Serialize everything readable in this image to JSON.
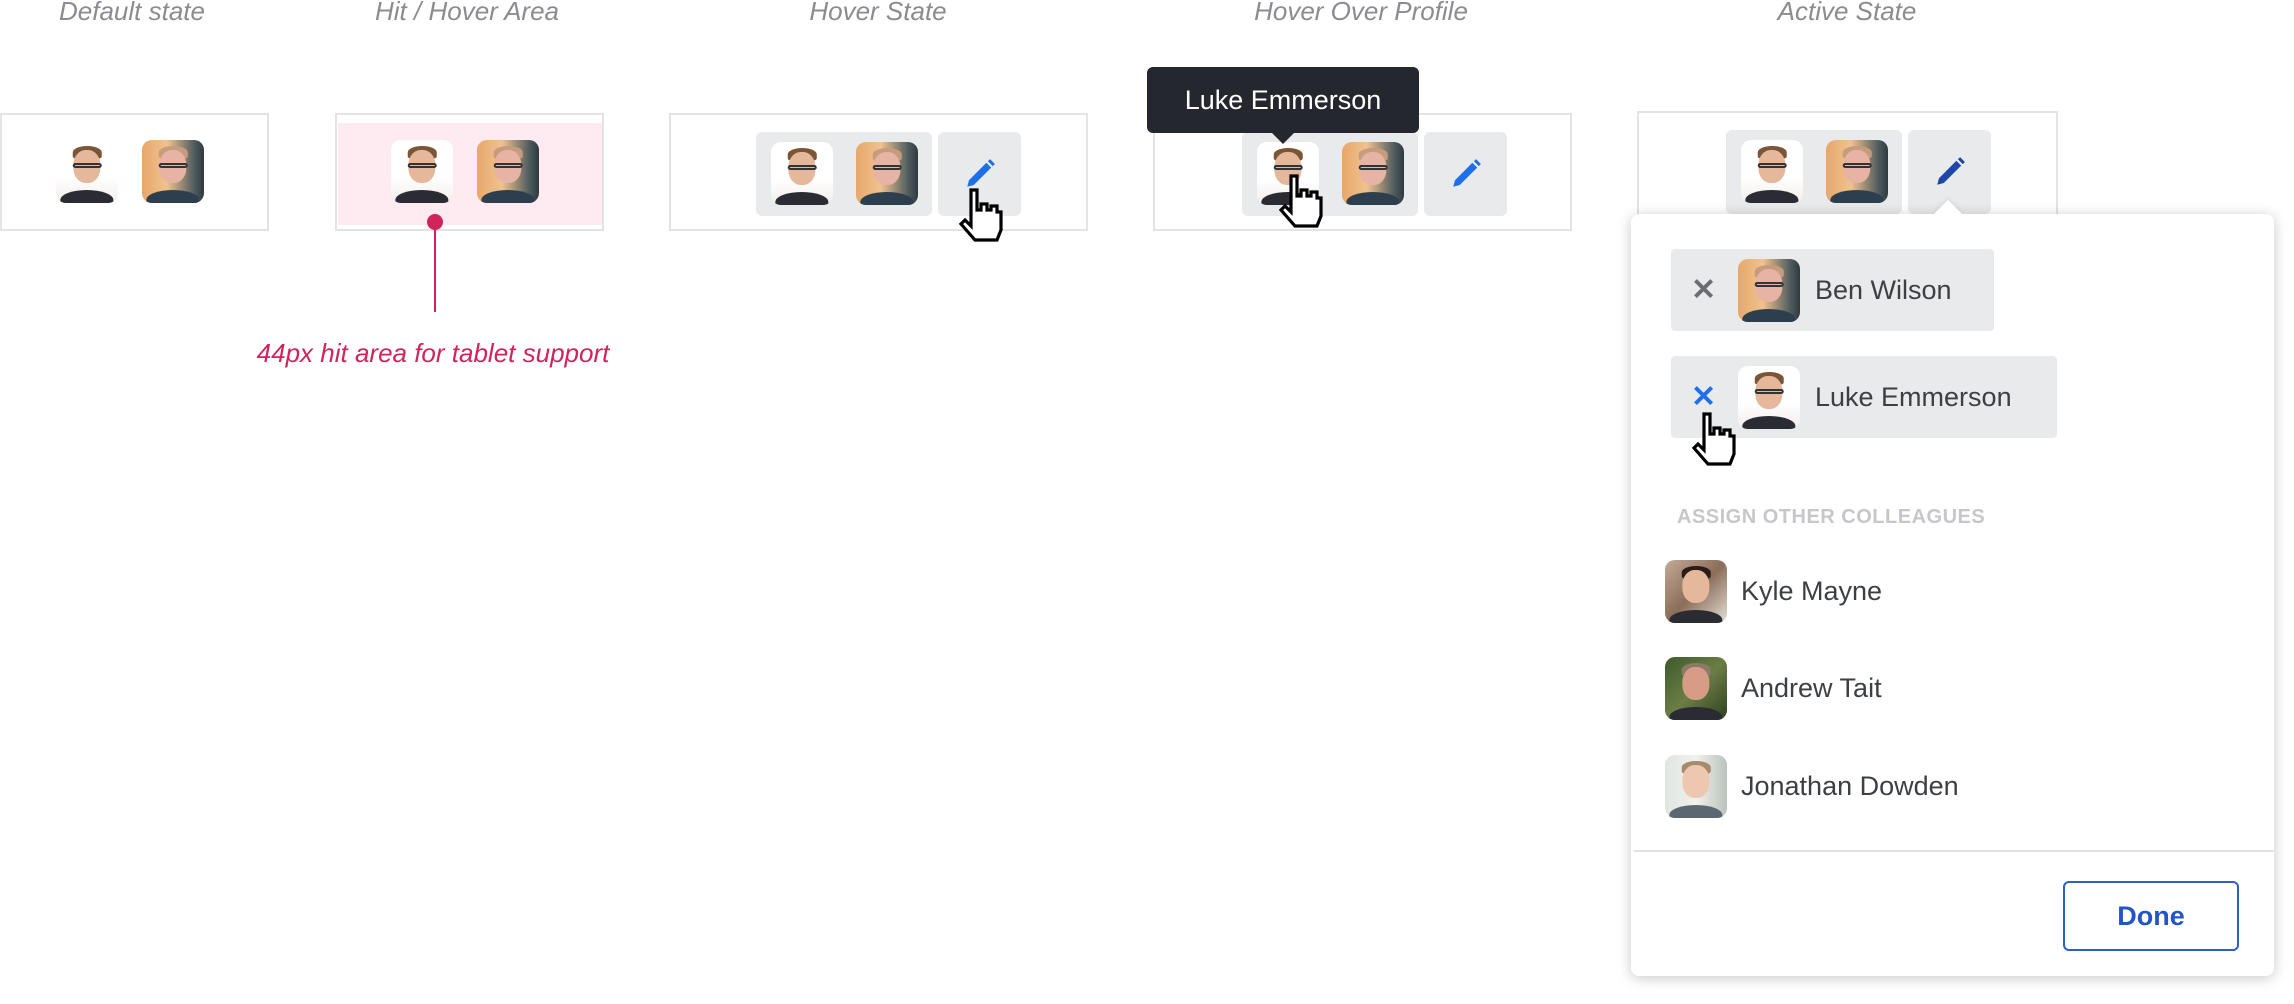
{
  "states": [
    {
      "label": "Default state"
    },
    {
      "label": "Hit / Hover Area"
    },
    {
      "label": "Hover State"
    },
    {
      "label": "Hover Over Profile"
    },
    {
      "label": "Active State"
    }
  ],
  "annotation": {
    "text": "44px hit area for tablet support",
    "color": "#d0245a"
  },
  "tooltip": {
    "text": "Luke Emmerson"
  },
  "assigned": [
    {
      "name": "Ben Wilson",
      "avatar": "ben"
    },
    {
      "name": "Luke Emmerson",
      "avatar": "luke"
    }
  ],
  "section_heading": "ASSIGN OTHER COLLEAGUES",
  "colleagues": [
    {
      "name": "Kyle Mayne",
      "avatar": "kyle"
    },
    {
      "name": "Andrew Tait",
      "avatar": "andrew"
    },
    {
      "name": "Jonathan Dowden",
      "avatar": "jon"
    }
  ],
  "done_label": "Done",
  "colors": {
    "accent": "#1f6fe8",
    "hit_area": "#fdebf1",
    "chip_bg": "#e9eaec",
    "tooltip_bg": "#24272d"
  }
}
